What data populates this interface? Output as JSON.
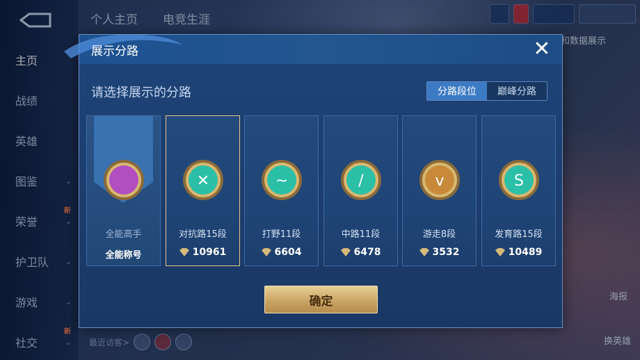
{
  "background": {
    "top_tabs": [
      "个人主页",
      "电竞生涯"
    ],
    "sidebar": [
      {
        "label": "主页",
        "active": true,
        "has_chevron": false,
        "is_new": false
      },
      {
        "label": "战绩",
        "active": false,
        "has_chevron": false,
        "is_new": false
      },
      {
        "label": "英雄",
        "active": false,
        "has_chevron": false,
        "is_new": false
      },
      {
        "label": "图鉴",
        "active": false,
        "has_chevron": true,
        "is_new": false
      },
      {
        "label": "荣誉",
        "active": false,
        "has_chevron": true,
        "is_new": true
      },
      {
        "label": "护卫队",
        "active": false,
        "has_chevron": true,
        "is_new": false
      },
      {
        "label": "游戏",
        "active": false,
        "has_chevron": true,
        "is_new": false
      },
      {
        "label": "社交",
        "active": false,
        "has_chevron": true,
        "is_new": true
      }
    ],
    "new_tag": "新",
    "right_text_1": "和数据展示",
    "right_text_2": "海报",
    "right_text_3": "换英雄",
    "recent_visitors": "最近访客>"
  },
  "dialog": {
    "title": "展示分路",
    "close_icon": "close-icon",
    "subtitle": "请选择展示的分路",
    "tabs": [
      {
        "label": "分路段位",
        "active": true
      },
      {
        "label": "巅峰分路",
        "active": false
      }
    ],
    "cards": [
      {
        "name": "全能高手",
        "value": "全能称号",
        "selected": false,
        "kind": "title",
        "color": "#b24fc0"
      },
      {
        "name": "对抗路15段",
        "value": "10961",
        "selected": true,
        "kind": "lane",
        "color": "#2bbfa8"
      },
      {
        "name": "打野11段",
        "value": "6604",
        "selected": false,
        "kind": "lane",
        "color": "#2bbfa8"
      },
      {
        "name": "中路11段",
        "value": "6478",
        "selected": false,
        "kind": "lane",
        "color": "#2bbfa8"
      },
      {
        "name": "游走8段",
        "value": "3532",
        "selected": false,
        "kind": "lane",
        "color": "#c8893a"
      },
      {
        "name": "发育路15段",
        "value": "10489",
        "selected": false,
        "kind": "lane",
        "color": "#2bbfa8"
      }
    ],
    "confirm_label": "确定"
  },
  "colors": {
    "dialog_bg": "#1e4478",
    "accent_blue": "#3d7ac4",
    "gold": "#caa565",
    "selected_border": "#e9c58e"
  }
}
